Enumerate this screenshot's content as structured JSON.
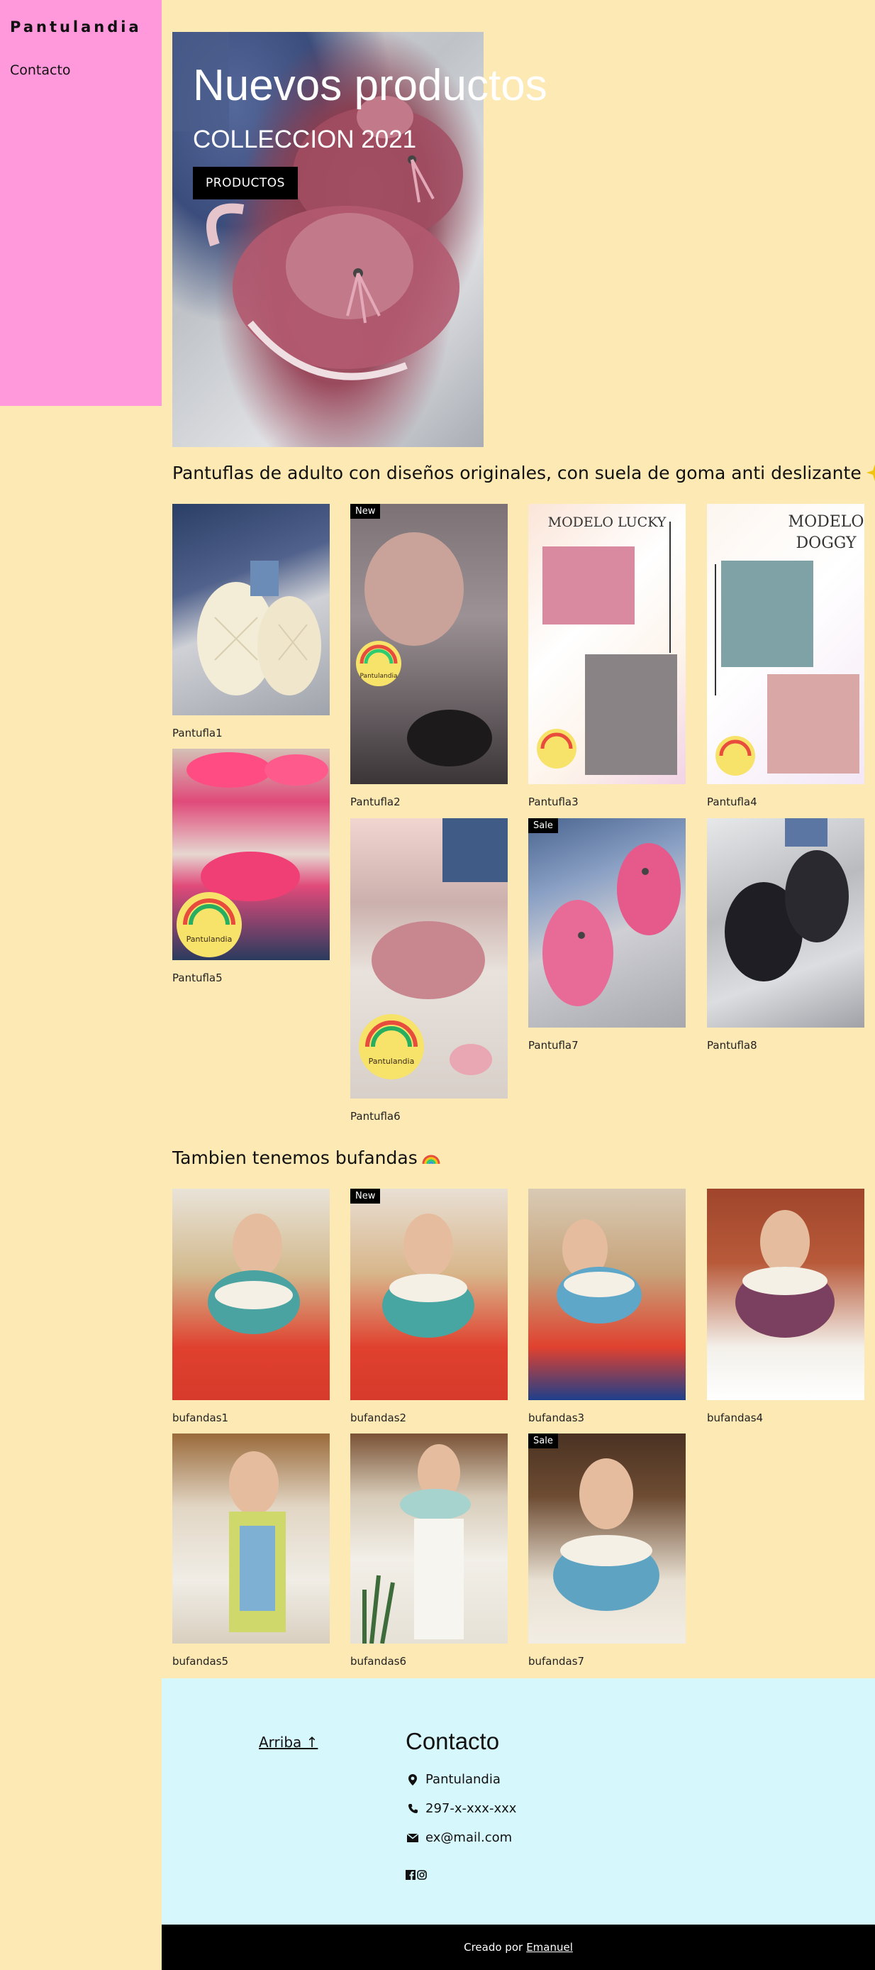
{
  "sidebar": {
    "brand": "Pantulandia",
    "link_contact": "Contacto"
  },
  "hero": {
    "title": "Nuevos productos",
    "subtitle": "COLLECCION 2021",
    "button": "PRODUCTOS"
  },
  "pantuflas": {
    "title": "Pantuflas de adulto con diseños originales, con suela de goma anti deslizante",
    "items": [
      {
        "caption": "Pantufla1",
        "badge": ""
      },
      {
        "caption": "Pantufla2",
        "badge": "New"
      },
      {
        "caption": "Pantufla3",
        "badge": ""
      },
      {
        "caption": "Pantufla4",
        "badge": ""
      },
      {
        "caption": "Pantufla5",
        "badge": ""
      },
      {
        "caption": "Pantufla6",
        "badge": ""
      },
      {
        "caption": "Pantufla7",
        "badge": "Sale"
      },
      {
        "caption": "Pantufla8",
        "badge": ""
      }
    ],
    "image_text": {
      "lucky": "MODELO LUCKY",
      "doggy_1": "MODELO",
      "doggy_2": "DOGGY",
      "logo": "Pantulandia"
    }
  },
  "bufandas": {
    "title": "Tambien tenemos bufandas",
    "items": [
      {
        "caption": "bufandas1",
        "badge": ""
      },
      {
        "caption": "bufandas2",
        "badge": "New"
      },
      {
        "caption": "bufandas3",
        "badge": ""
      },
      {
        "caption": "bufandas4",
        "badge": ""
      },
      {
        "caption": "bufandas5",
        "badge": ""
      },
      {
        "caption": "bufandas6",
        "badge": ""
      },
      {
        "caption": "bufandas7",
        "badge": "Sale"
      }
    ]
  },
  "footer": {
    "up_link": "Arriba ↑",
    "contact_title": "Contacto",
    "address": "Pantulandia",
    "phone": "297-x-xxx-xxx",
    "email": "ex@mail.com",
    "credit_prefix": "Creado por",
    "credit_author": "Emanuel"
  },
  "colors": {
    "page_bg": "#fde9b4",
    "sidebar_bg": "#ff99dc",
    "footer_bg": "#d6f7fb",
    "bottom_bar": "#000000"
  }
}
